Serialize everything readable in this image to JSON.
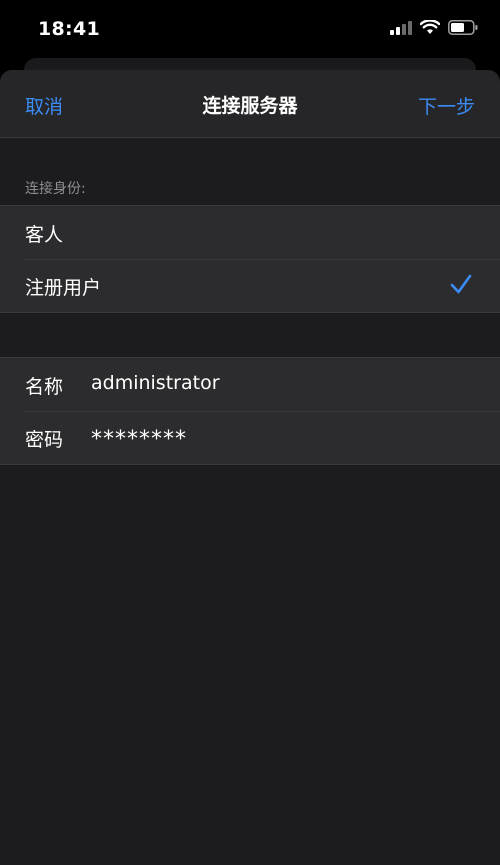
{
  "status_bar": {
    "time": "18:41",
    "icons": [
      "signal-icon",
      "wifi-icon",
      "battery-icon"
    ]
  },
  "navbar": {
    "cancel_label": "取消",
    "title": "连接服务器",
    "next_label": "下一步"
  },
  "identity_section": {
    "header": "连接身份:",
    "options": [
      {
        "label": "客人",
        "selected": false
      },
      {
        "label": "注册用户",
        "selected": true
      }
    ]
  },
  "credentials": {
    "name_label": "名称",
    "name_value": "administrator",
    "password_label": "密码",
    "password_value": "********"
  },
  "colors": {
    "accent": "#3b8cf6",
    "background": "#1c1c1e",
    "cell": "#2c2c2e",
    "separator": "#3a3a3c"
  }
}
